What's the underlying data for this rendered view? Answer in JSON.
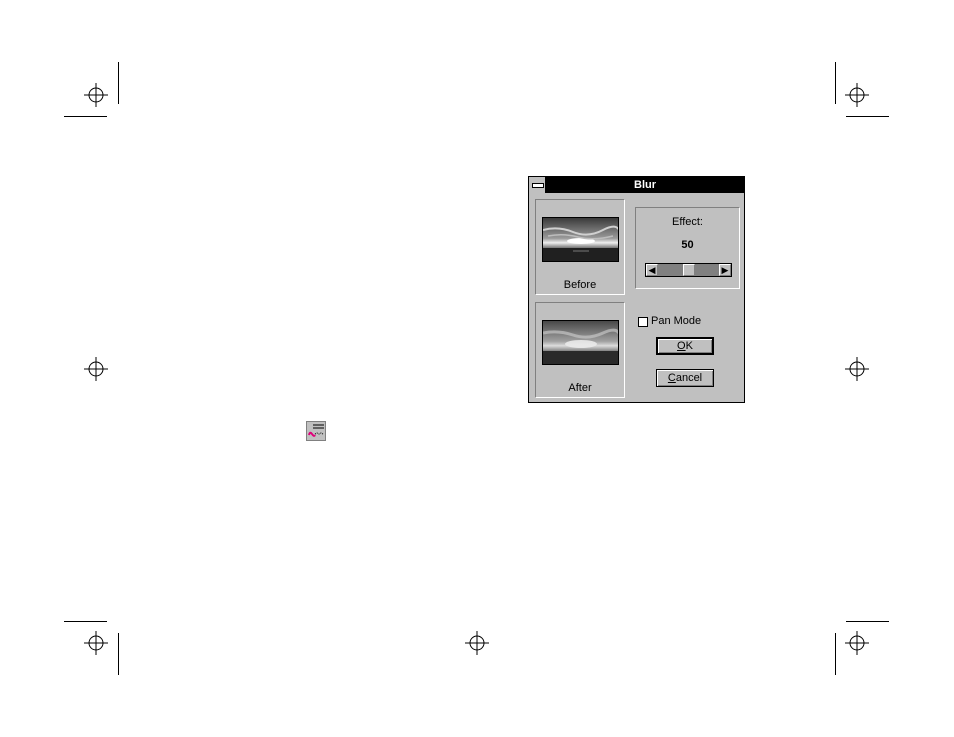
{
  "dialog": {
    "title": "Blur",
    "before_label": "Before",
    "after_label": "After",
    "effect_label": "Effect:",
    "effect_value": "50",
    "effect_level_fraction": 0.5,
    "pan_mode_label": "Pan Mode",
    "pan_mode_checked": false,
    "ok_label": "OK",
    "ok_mnemonic": "O",
    "ok_rest": "K",
    "cancel_label": "Cancel",
    "cancel_mnemonic": "C",
    "cancel_rest": "ancel"
  },
  "icons": {
    "tool": "blur-tool-icon",
    "system_menu": "system-menu-icon",
    "scroll_left": "scroll-left-arrow-icon",
    "scroll_right": "scroll-right-arrow-icon",
    "crop_marks": "registration-mark-icon"
  },
  "colors": {
    "dialog_bg": "#c0c0c0",
    "titlebar_bg": "#000000",
    "titlebar_text": "#ffffff"
  }
}
